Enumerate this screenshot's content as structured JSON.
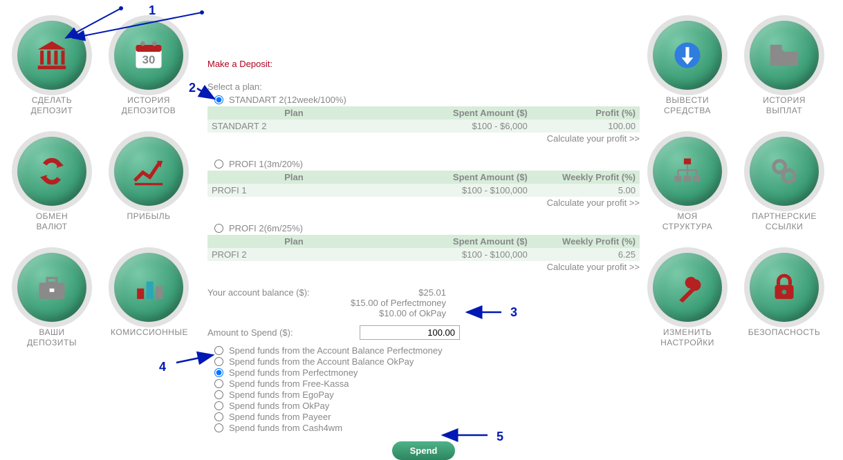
{
  "title": "Make a Deposit:",
  "select_plan_label": "Select a plan:",
  "plans": [
    {
      "radio_label": "STANDART 2(12week/100%)",
      "selected": true,
      "headers": [
        "Plan",
        "Spent Amount ($)",
        "Profit (%)"
      ],
      "name": "STANDART 2",
      "spent": "$100 - $6,000",
      "profit": "100.00",
      "calc": "Calculate your profit >>"
    },
    {
      "radio_label": "PROFI 1(3m/20%)",
      "selected": false,
      "headers": [
        "Plan",
        "Spent Amount ($)",
        "Weekly Profit (%)"
      ],
      "name": "PROFI 1",
      "spent": "$100 - $100,000",
      "profit": "5.00",
      "calc": "Calculate your profit >>"
    },
    {
      "radio_label": "PROFI 2(6m/25%)",
      "selected": false,
      "headers": [
        "Plan",
        "Spent Amount ($)",
        "Weekly Profit (%)"
      ],
      "name": "PROFI 2",
      "spent": "$100 - $100,000",
      "profit": "6.25",
      "calc": "Calculate your profit >>"
    }
  ],
  "balance": {
    "label": "Your account balance ($):",
    "total": "$25.01",
    "pm": "$15.00 of Perfectmoney",
    "ok": "$10.00 of OkPay"
  },
  "spend": {
    "label": "Amount to Spend ($):",
    "value": "100.00"
  },
  "fund_options": [
    {
      "label": "Spend funds from the Account Balance Perfectmoney",
      "selected": false
    },
    {
      "label": "Spend funds from the Account Balance OkPay",
      "selected": false
    },
    {
      "label": "Spend funds from Perfectmoney",
      "selected": true
    },
    {
      "label": "Spend funds from Free-Kassa",
      "selected": false
    },
    {
      "label": "Spend funds from EgoPay",
      "selected": false
    },
    {
      "label": "Spend funds from OkPay",
      "selected": false
    },
    {
      "label": "Spend funds from Payeer",
      "selected": false
    },
    {
      "label": "Spend funds from Cash4wm",
      "selected": false
    }
  ],
  "spend_btn": "Spend",
  "left_nav": [
    {
      "label": "СДЕЛАТЬ\nДЕПОЗИТ",
      "icon": "bank"
    },
    {
      "label": "ИСТОРИЯ\nДЕПОЗИТОВ",
      "icon": "calendar"
    },
    {
      "label": "ОБМЕН\nВАЛЮТ",
      "icon": "exchange"
    },
    {
      "label": "ПРИБЫЛЬ",
      "icon": "trend"
    },
    {
      "label": "ВАШИ\nДЕПОЗИТЫ",
      "icon": "briefcase"
    },
    {
      "label": "КОМИССИОННЫЕ",
      "icon": "bars"
    }
  ],
  "right_nav": [
    {
      "label": "ВЫВЕСТИ\nСРЕДСТВА",
      "icon": "download"
    },
    {
      "label": "ИСТОРИЯ\nВЫПЛАТ",
      "icon": "folder"
    },
    {
      "label": "МОЯ\nСТРУКТУРА",
      "icon": "structure"
    },
    {
      "label": "ПАРТНЕРСКИЕ\nССЫЛКИ",
      "icon": "link"
    },
    {
      "label": "ИЗМЕНИТЬ\nНАСТРОЙКИ",
      "icon": "wrench"
    },
    {
      "label": "БЕЗОПАСНОСТЬ",
      "icon": "lock"
    }
  ],
  "annotations": {
    "n1": "1",
    "n2": "2",
    "n3": "3",
    "n4": "4",
    "n5": "5"
  }
}
